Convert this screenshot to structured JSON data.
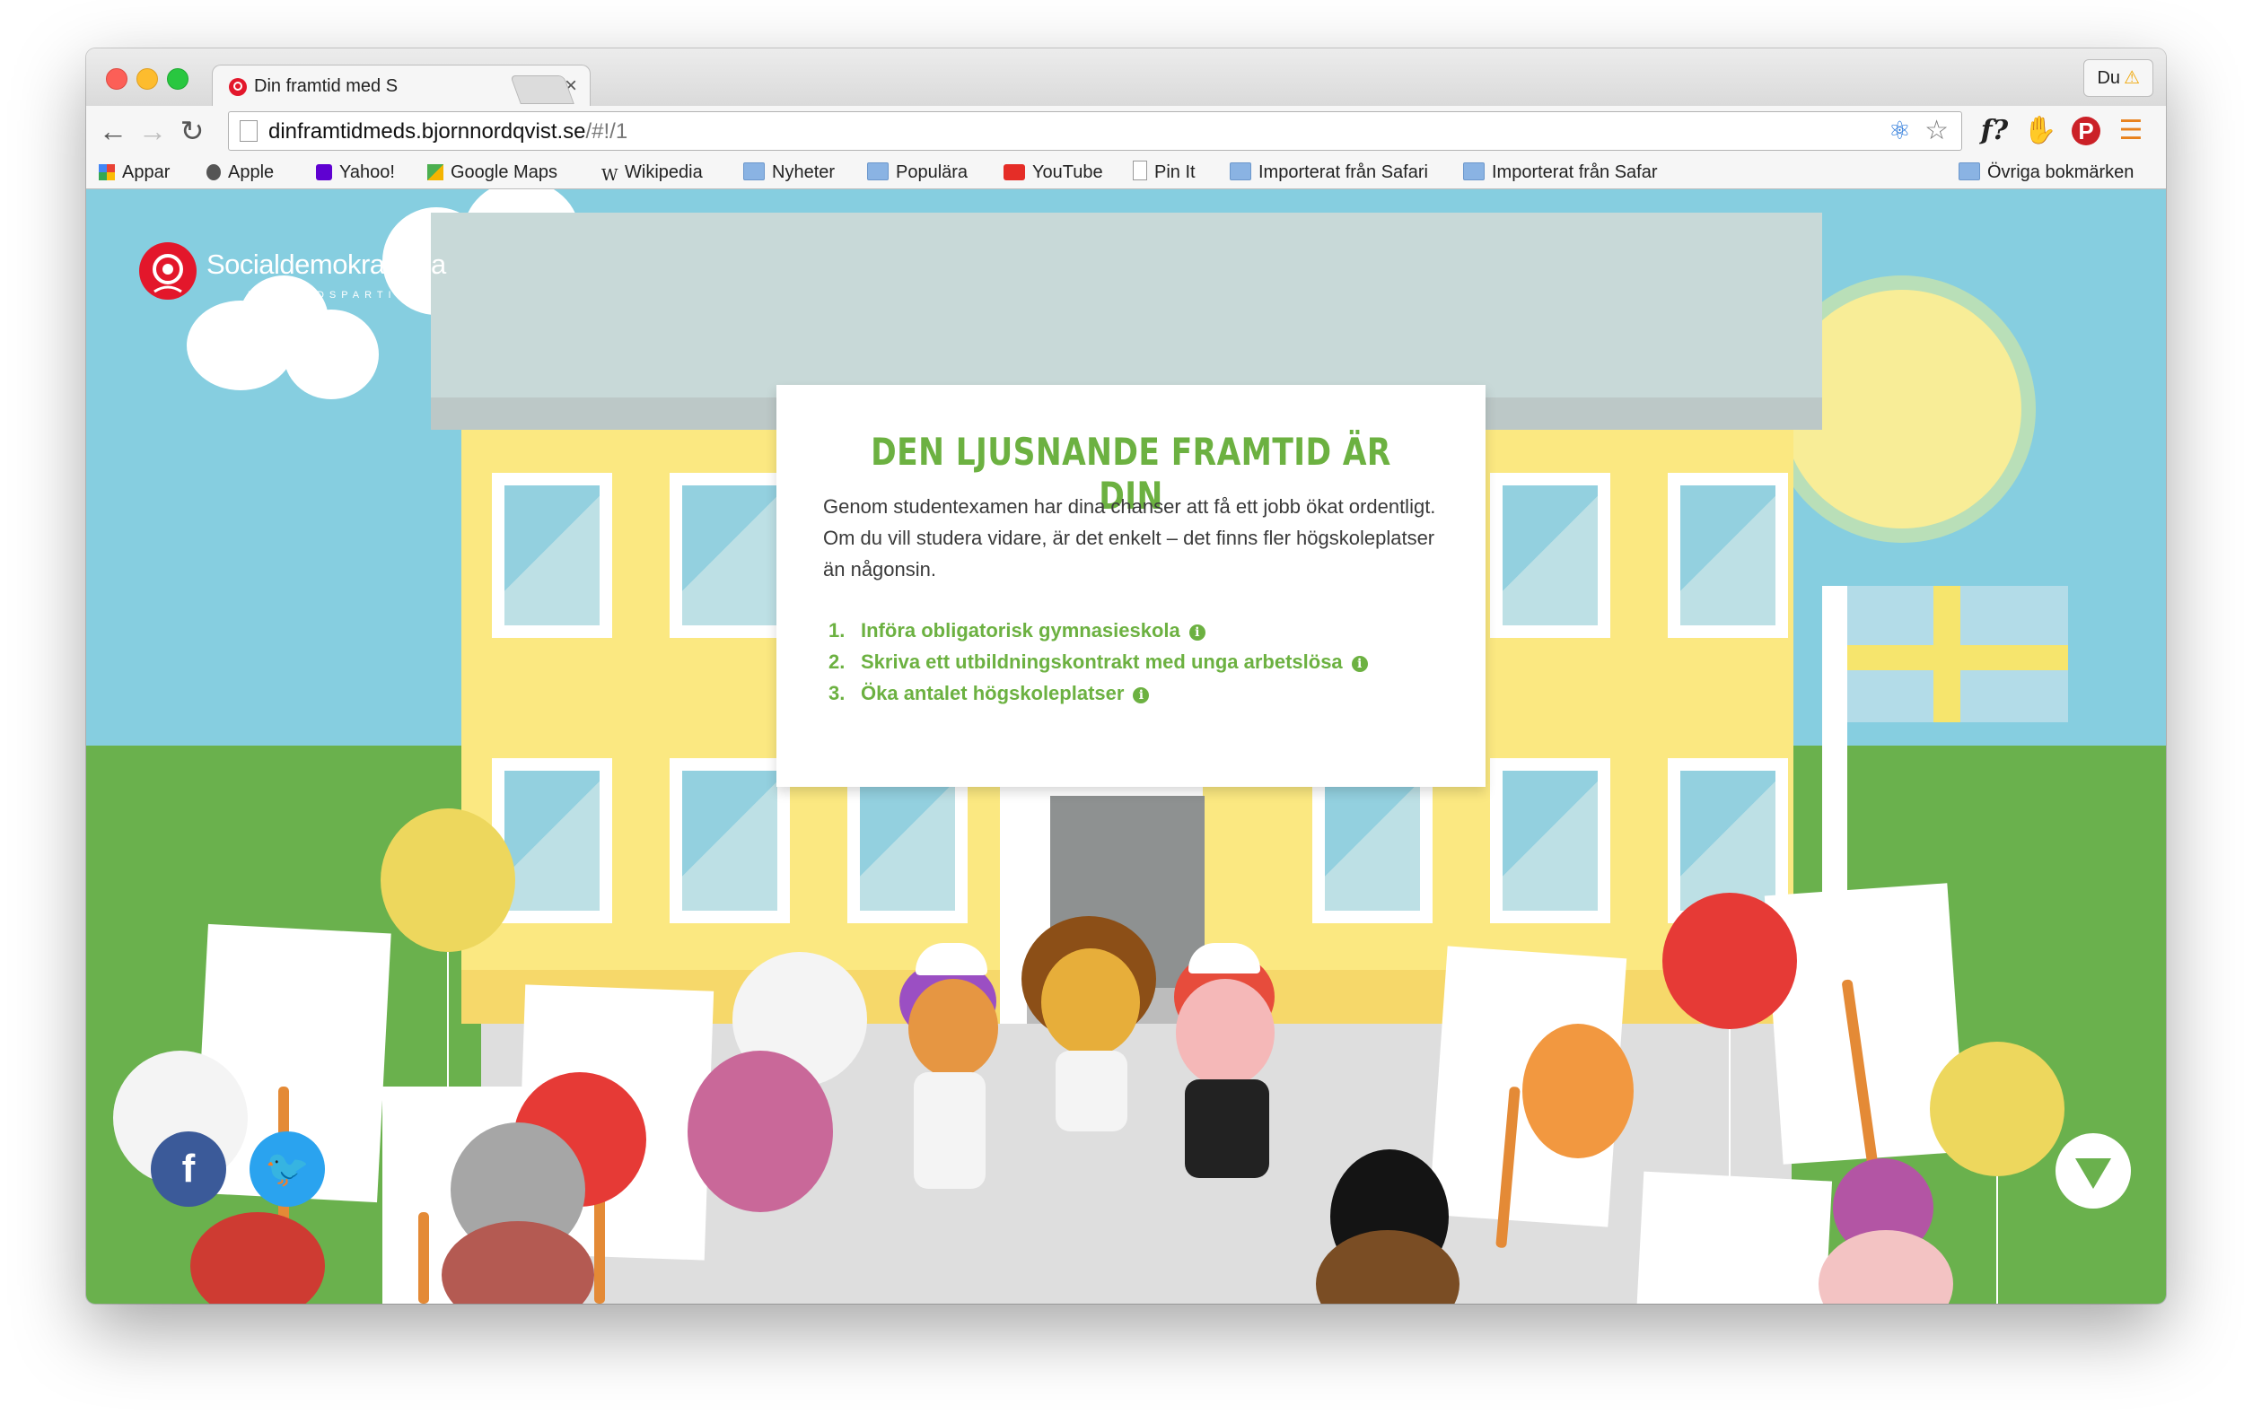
{
  "browser": {
    "tab_title": "Din framtid med S",
    "tab_close": "×",
    "profile": "Du",
    "url_host": "dinframtidmeds.bjornnordqvist.se",
    "url_path": "/#!/1"
  },
  "bookmarks": [
    {
      "label": "Appar",
      "icon": "apps-grid-icon"
    },
    {
      "label": "Apple",
      "icon": "apple-icon"
    },
    {
      "label": "Yahoo!",
      "icon": "yahoo-icon"
    },
    {
      "label": "Google Maps",
      "icon": "google-maps-icon"
    },
    {
      "label": "Wikipedia",
      "icon": "wikipedia-icon"
    },
    {
      "label": "Nyheter",
      "icon": "folder-icon"
    },
    {
      "label": "Populära",
      "icon": "folder-icon"
    },
    {
      "label": "YouTube",
      "icon": "youtube-icon"
    },
    {
      "label": "Pin It",
      "icon": "page-icon"
    },
    {
      "label": "Importerat från Safari",
      "icon": "folder-icon"
    },
    {
      "label": "Importerat från Safar",
      "icon": "folder-icon"
    },
    {
      "label": "Övriga bokmärken",
      "icon": "folder-icon"
    }
  ],
  "logo": {
    "name": "Socialdemokraterna",
    "tagline": "FRAMTIDSPARTIET"
  },
  "card": {
    "title": "DEN LJUSNANDE FRAMTID ÄR DIN",
    "body": "Genom studentexamen har dina chanser att få ett jobb ökat ordentligt. Om du vill studera vidare, är det enkelt – det finns fler högskoleplatser än någonsin.",
    "items": [
      {
        "num": "1.",
        "text": "Införa obligatorisk gymnasieskola"
      },
      {
        "num": "2.",
        "text": "Skriva ett utbildningskontrakt med unga arbetslösa"
      },
      {
        "num": "3.",
        "text": "Öka antalet högskoleplatser"
      }
    ]
  },
  "colors": {
    "accent_green": "#6cb141",
    "sky": "#86cee0",
    "grass": "#6ab14d",
    "building": "#fbe881",
    "facebook": "#3b5a99",
    "twitter": "#2aa3ef"
  }
}
